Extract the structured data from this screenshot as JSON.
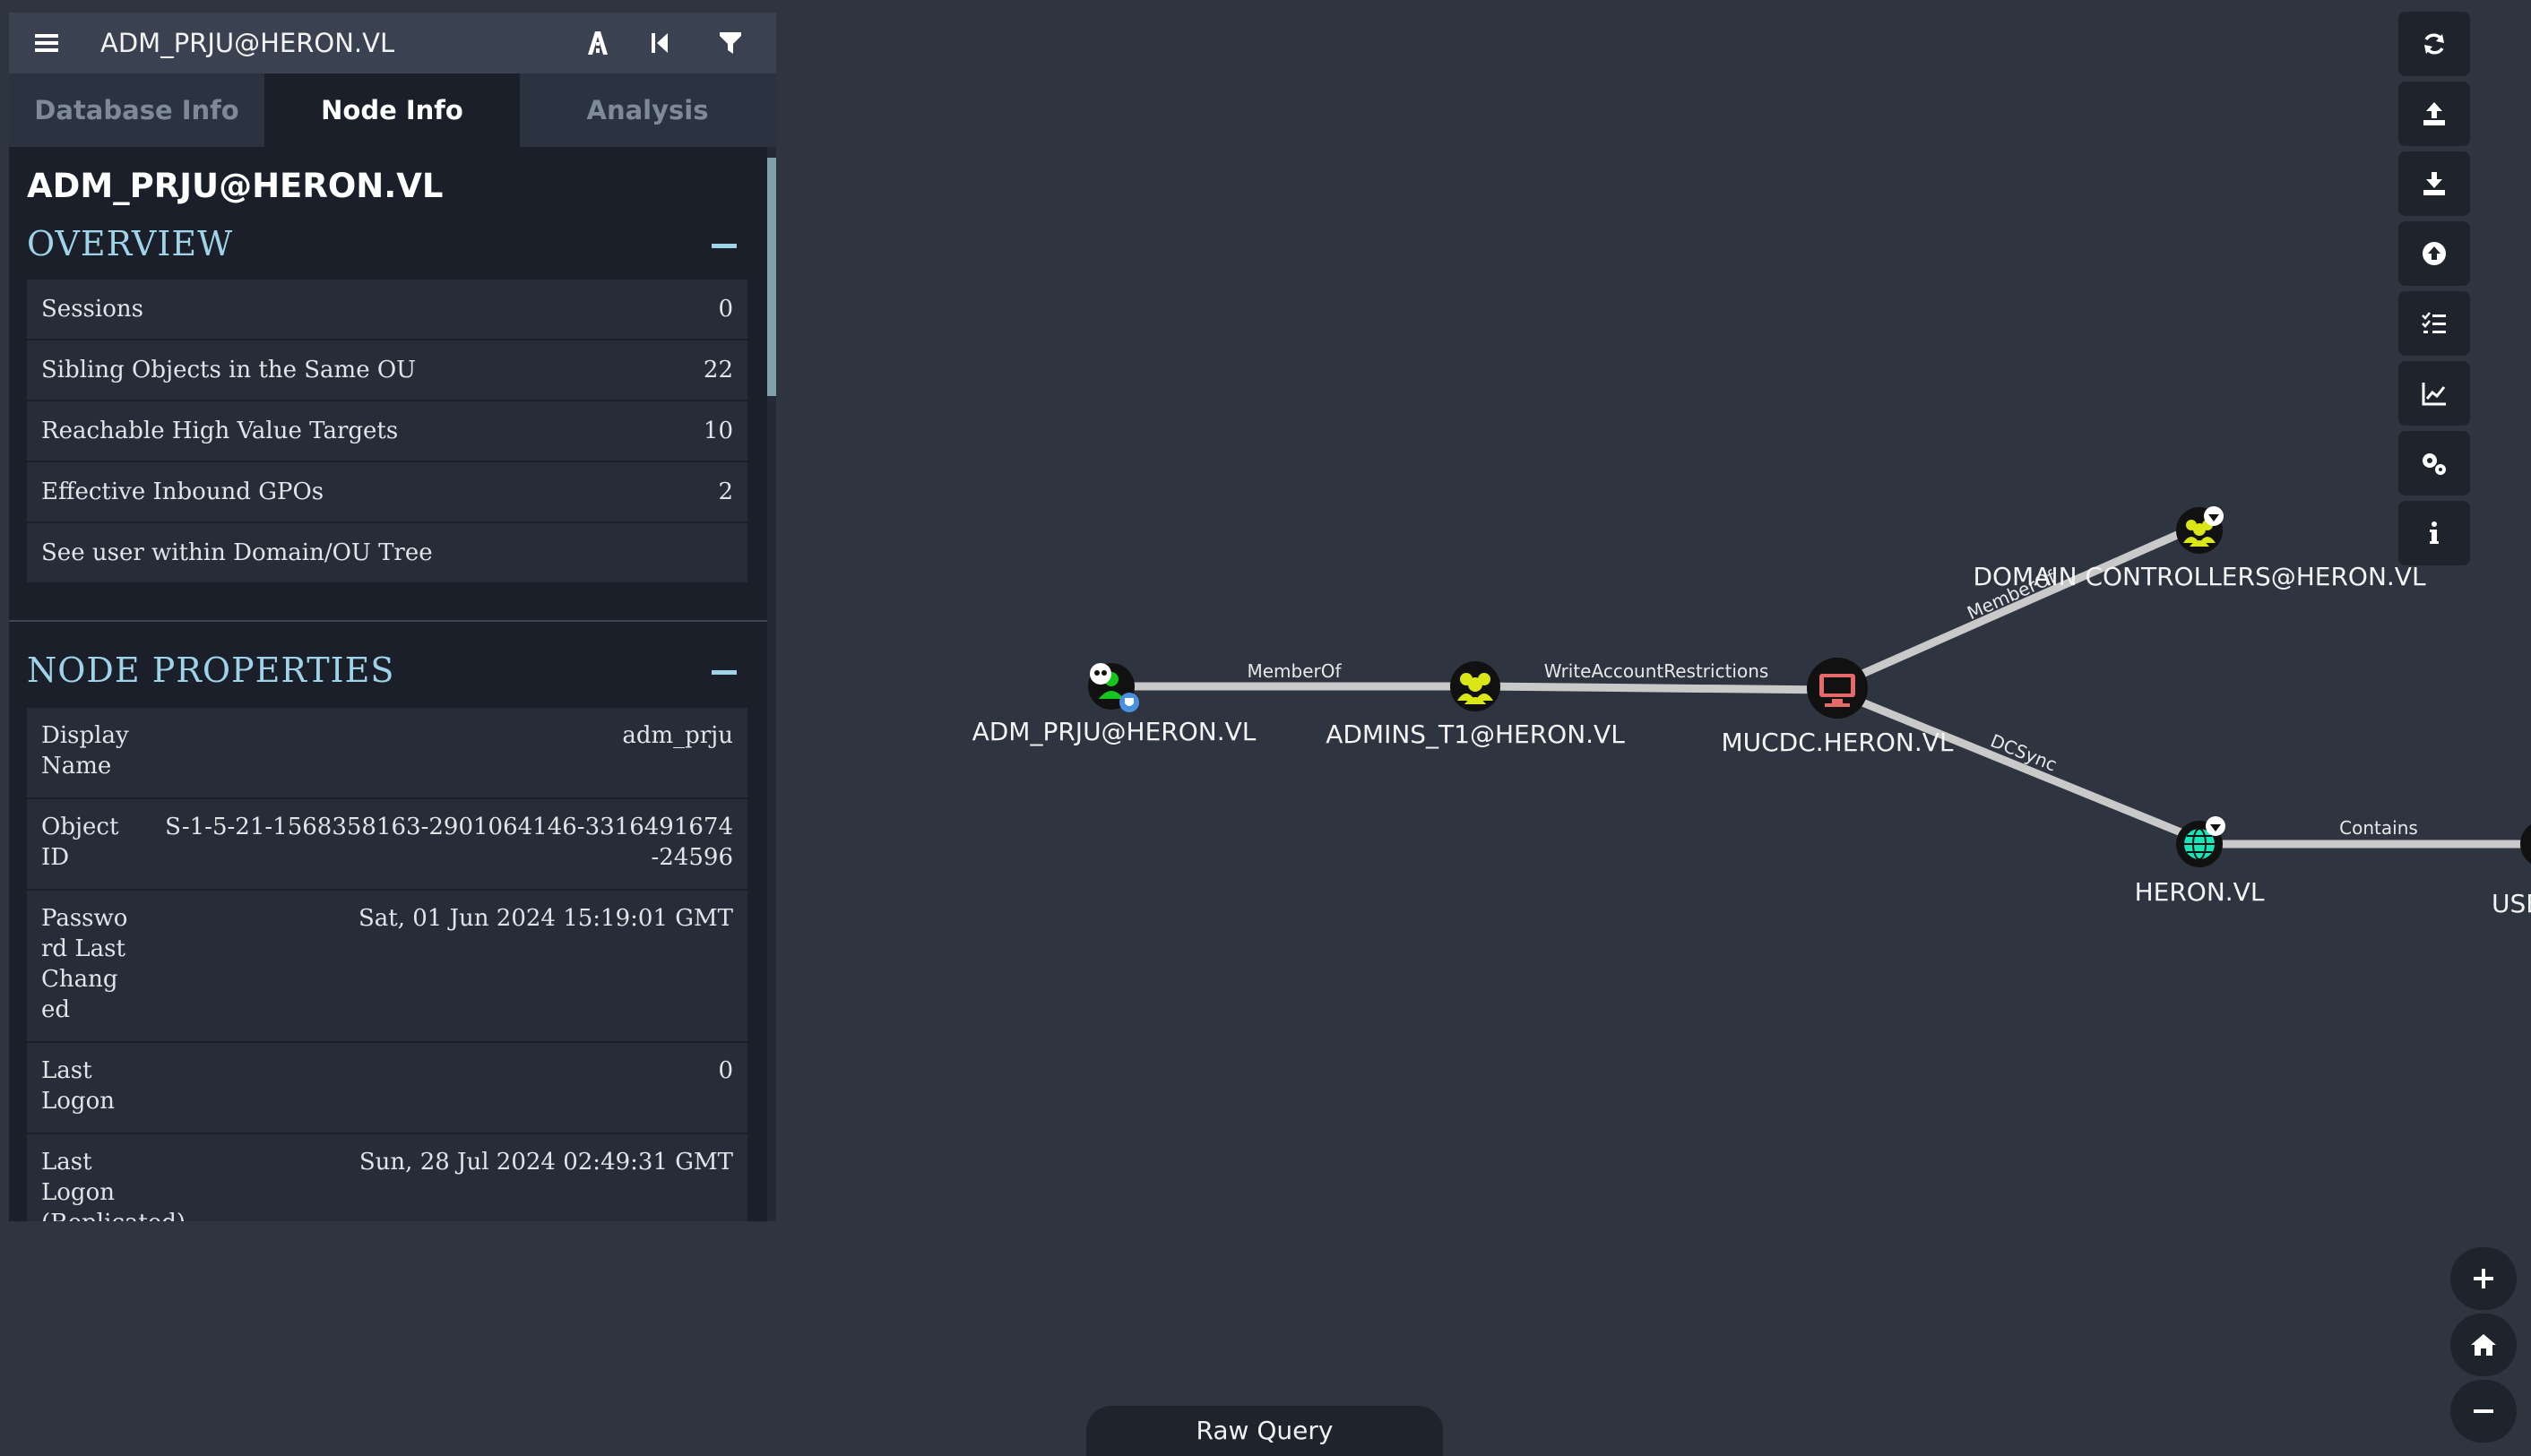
{
  "search": {
    "title": "ADM_PRJU@HERON.VL"
  },
  "tabs": [
    {
      "label": "Database Info"
    },
    {
      "label": "Node Info"
    },
    {
      "label": "Analysis"
    }
  ],
  "node_info": {
    "name": "ADM_PRJU@HERON.VL",
    "overview": {
      "title": "OVERVIEW",
      "rows": [
        {
          "label": "Sessions",
          "value": "0"
        },
        {
          "label": "Sibling Objects in the Same OU",
          "value": "22"
        },
        {
          "label": "Reachable High Value Targets",
          "value": "10"
        },
        {
          "label": "Effective Inbound GPOs",
          "value": "2"
        },
        {
          "label": "See user within Domain/OU Tree",
          "value": ""
        }
      ]
    },
    "properties": {
      "title": "NODE PROPERTIES",
      "rows": [
        {
          "label": "Display Name",
          "value": "adm_prju"
        },
        {
          "label": "Object ID",
          "value": "S-1-5-21-1568358163-2901064146-3316491674-24596"
        },
        {
          "label": "Password Last Changed",
          "value": "Sat, 01 Jun 2024 15:19:01 GMT"
        },
        {
          "label": "Last Logon",
          "value": "0"
        },
        {
          "label": "Last Logon (Replicated)",
          "value": "Sun, 28 Jul 2024 02:49:31 GMT"
        }
      ]
    }
  },
  "graph": {
    "nodes": [
      {
        "id": "adm",
        "label": "ADM_PRJU@HERON.VL",
        "type": "user-owned",
        "color": "#17c41f"
      },
      {
        "id": "admins",
        "label": "ADMINS_T1@HERON.VL",
        "type": "group",
        "color": "#dbe617"
      },
      {
        "id": "mucdc",
        "label": "MUCDC.HERON.VL",
        "type": "computer",
        "color": "#e66a6a"
      },
      {
        "id": "dc",
        "label": "DOMAIN CONTROLLERS@HERON.VL",
        "type": "group-highvalue",
        "color": "#dbe617"
      },
      {
        "id": "heron",
        "label": "HERON.VL",
        "type": "domain-highvalue",
        "color": "#17e6b9"
      },
      {
        "id": "users",
        "label": "USERS@",
        "type": "container",
        "color": "#f4f4f4"
      }
    ],
    "edges": [
      {
        "label": "MemberOf"
      },
      {
        "label": "WriteAccountRestrictions"
      },
      {
        "label": "MemberOf"
      },
      {
        "label": "DCSync"
      },
      {
        "label": "Contains"
      }
    ]
  },
  "toolbar": {
    "icons": [
      "refresh-icon",
      "upload-icon",
      "download-icon",
      "arrow-up-circle-icon",
      "checklist-icon",
      "chart-line-icon",
      "settings-icon",
      "info-icon"
    ],
    "zoom": [
      "zoom-in-icon",
      "home-icon",
      "zoom-out-icon"
    ]
  },
  "raw_query": {
    "label": "Raw Query"
  }
}
